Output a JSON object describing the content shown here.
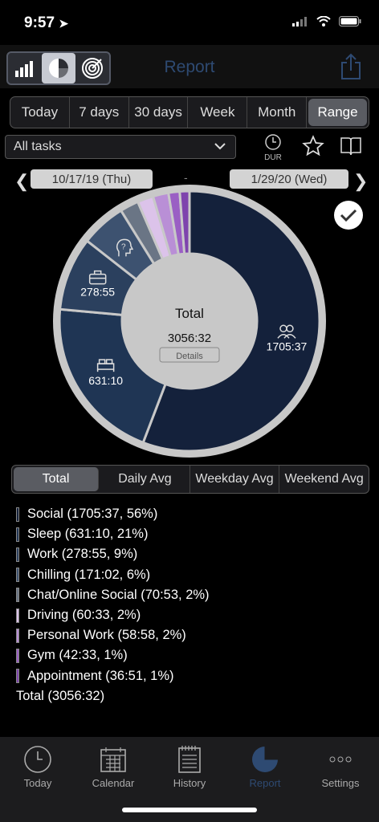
{
  "status": {
    "time": "9:57"
  },
  "nav": {
    "title": "Report"
  },
  "range_tabs": [
    "Today",
    "7 days",
    "30 days",
    "Week",
    "Month",
    "Range"
  ],
  "range_active": 5,
  "filter": {
    "selected": "All tasks",
    "dur_label": "DUR"
  },
  "dates": {
    "start": "10/17/19 (Thu)",
    "end": "1/29/20 (Wed)",
    "separator": "-"
  },
  "chart_data": {
    "type": "pie",
    "title": "Total",
    "total_value": "3056:32",
    "details_label": "Details",
    "slices": [
      {
        "name": "Social",
        "value": 1705.62,
        "label": "1705:37",
        "color": "#14213b",
        "icon": "people-icon"
      },
      {
        "name": "Sleep",
        "value": 631.17,
        "label": "631:10",
        "color": "#1f3554",
        "icon": "bed-icon"
      },
      {
        "name": "Work",
        "value": 278.92,
        "label": "278:55",
        "color": "#2b405e",
        "icon": "briefcase-icon"
      },
      {
        "name": "Chilling",
        "value": 171.03,
        "label": "",
        "color": "#3d5270",
        "icon": "head-question-icon"
      },
      {
        "name": "Chat/Online Social",
        "value": 70.88,
        "label": "",
        "color": "#6a7585",
        "icon": ""
      },
      {
        "name": "Driving",
        "value": 60.55,
        "label": "",
        "color": "#dcc3ea",
        "icon": ""
      },
      {
        "name": "Personal Work",
        "value": 58.97,
        "label": "",
        "color": "#b98fd6",
        "icon": ""
      },
      {
        "name": "Gym",
        "value": 42.55,
        "label": "",
        "color": "#9a5fc4",
        "icon": ""
      },
      {
        "name": "Appointment",
        "value": 36.85,
        "label": "",
        "color": "#7e44ad",
        "icon": ""
      }
    ]
  },
  "stats_tabs": [
    "Total",
    "Daily Avg",
    "Weekday Avg",
    "Weekend Avg"
  ],
  "stats_active": 0,
  "legend": [
    {
      "text": "Social (1705:37, 56%)",
      "color": "#14213b"
    },
    {
      "text": "Sleep (631:10, 21%)",
      "color": "#1f3554"
    },
    {
      "text": "Work (278:55, 9%)",
      "color": "#2b405e"
    },
    {
      "text": "Chilling (171:02, 6%)",
      "color": "#3d5270"
    },
    {
      "text": "Chat/Online Social (70:53, 2%)",
      "color": "#6a7585"
    },
    {
      "text": "Driving (60:33, 2%)",
      "color": "#dcc3ea"
    },
    {
      "text": "Personal Work (58:58, 2%)",
      "color": "#b98fd6"
    },
    {
      "text": "Gym (42:33, 1%)",
      "color": "#9a5fc4"
    },
    {
      "text": "Appointment (36:51, 1%)",
      "color": "#7e44ad"
    }
  ],
  "legend_total": "Total (3056:32)",
  "tabbar": [
    {
      "label": "Today",
      "icon": "clock-icon"
    },
    {
      "label": "Calendar",
      "icon": "calendar-icon"
    },
    {
      "label": "History",
      "icon": "notepad-icon"
    },
    {
      "label": "Report",
      "icon": "pie-chart-icon"
    },
    {
      "label": "Settings",
      "icon": "dots-icon"
    }
  ],
  "tabbar_active": 3,
  "colors": {
    "accent": "#2e4a72"
  }
}
